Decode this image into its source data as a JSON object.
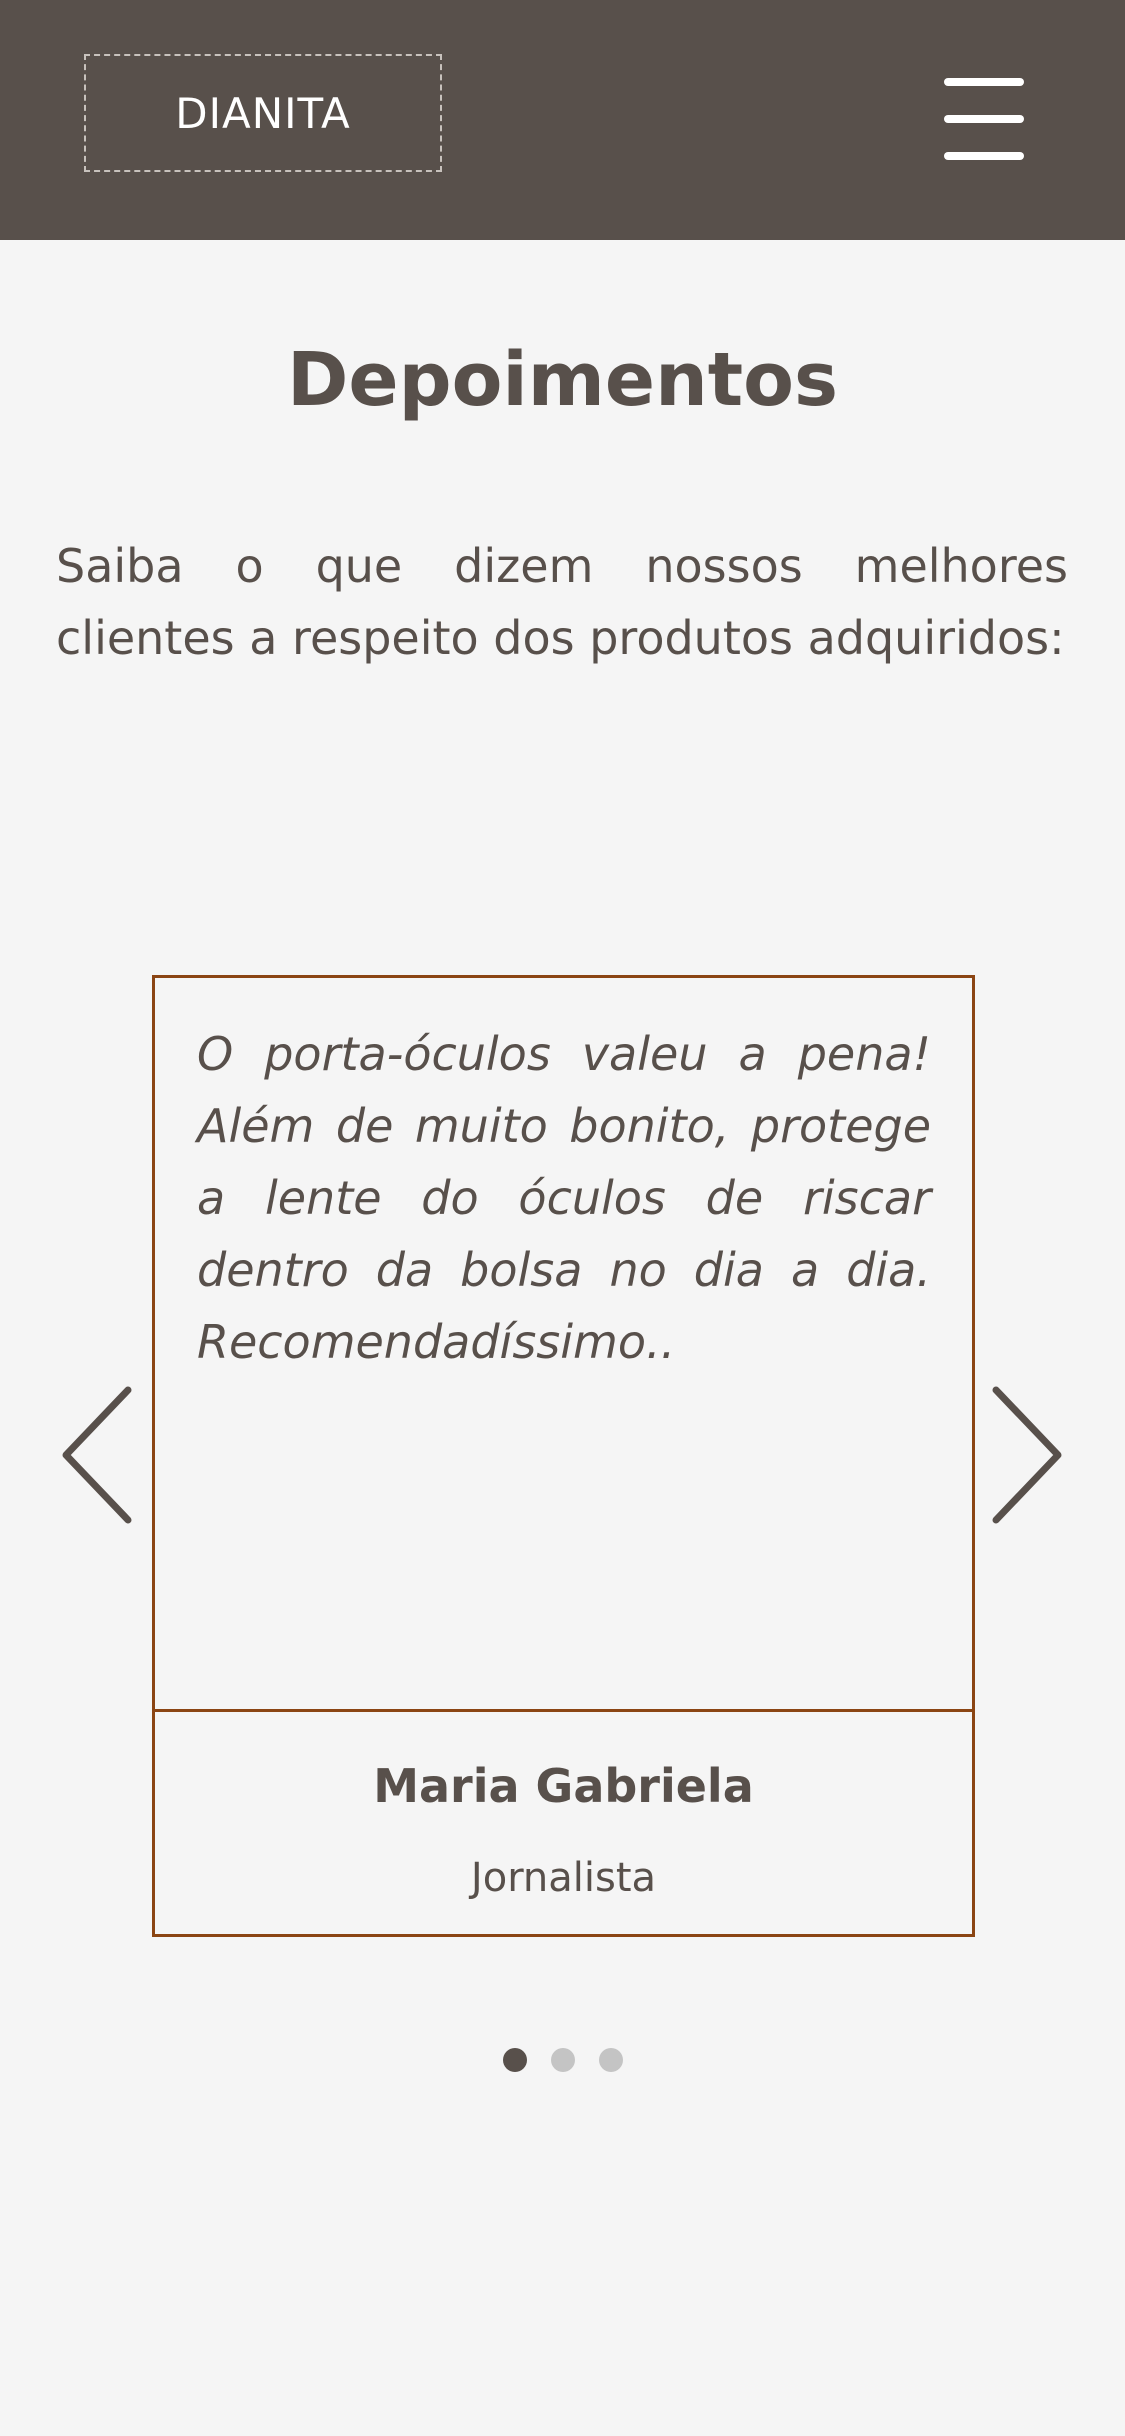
{
  "header": {
    "logo_text": "DIANITA",
    "menu_icon": "hamburger-menu-icon",
    "background_color": "#58504b"
  },
  "section": {
    "title": "Depoimentos",
    "intro": "Saiba o que dizem nossos melhores clientes a respeito dos produtos adquiridos:"
  },
  "carousel": {
    "prev_icon": "chevron-left-icon",
    "next_icon": "chevron-right-icon",
    "testimonial": {
      "quote": "O porta-óculos valeu a pena! Além de muito bonito, protege a lente do óculos de riscar dentro da bolsa no dia a dia. Recomendadíssimo..",
      "author": "Maria Gabriela",
      "role": "Jornalista"
    },
    "total_slides": 3,
    "active_slide": 1,
    "border_color": "#8b4513"
  },
  "colors": {
    "text": "#58504b",
    "background": "#f5f5f5",
    "dot_inactive": "#c4c4c4"
  }
}
